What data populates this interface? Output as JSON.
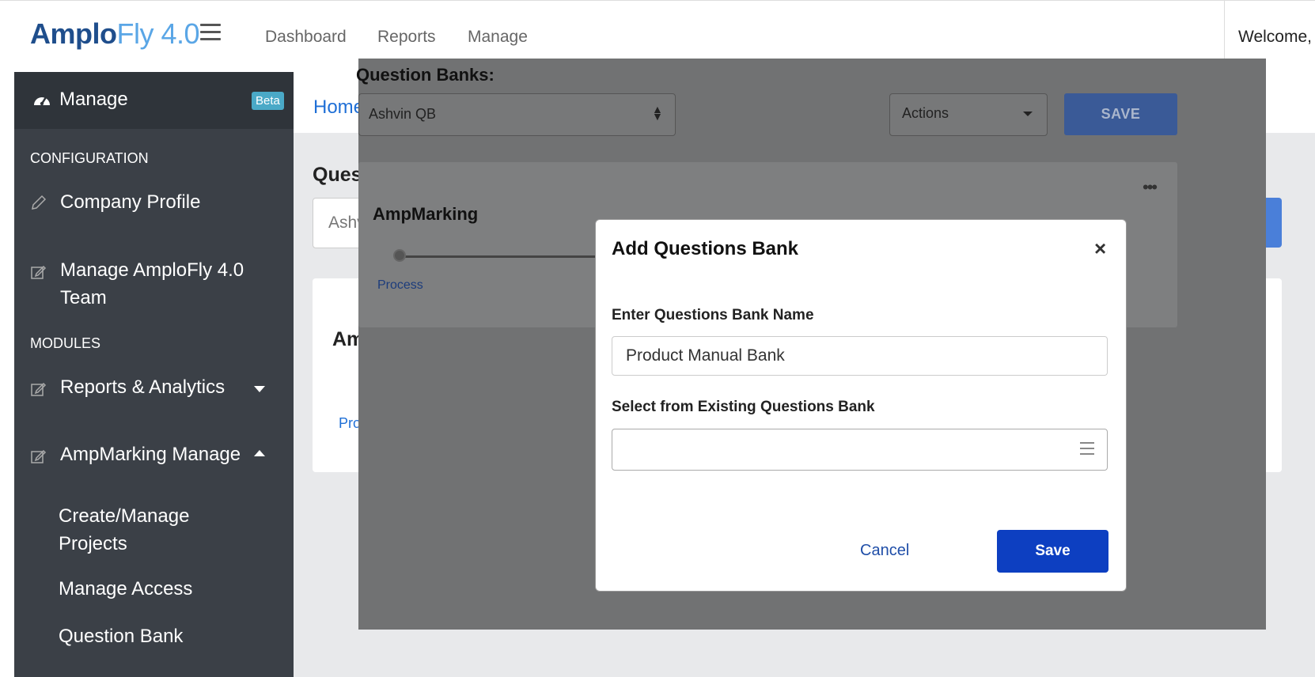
{
  "header": {
    "logo_bold": "Amplo",
    "logo_light": "Fly 4.0",
    "nav": [
      "Dashboard",
      "Reports",
      "Manage"
    ],
    "welcome": "Welcome,"
  },
  "sidebar": {
    "title": "Manage",
    "badge": "Beta",
    "section_config": "CONFIGURATION",
    "company_profile": "Company Profile",
    "manage_team_line1": "Manage AmploFly 4.0",
    "manage_team_line2": "Team",
    "section_modules": "MODULES",
    "reports_analytics": "Reports & Analytics",
    "ampmarking_manage": "AmpMarking Manage",
    "sub_create_line1": "Create/Manage",
    "sub_create_line2": "Projects",
    "sub_access": "Manage Access",
    "sub_question_bank": "Question Bank"
  },
  "background": {
    "breadcrumb_home": "Home",
    "title_fragment": "Ques",
    "select_fragment": "Ashv",
    "card_title_fragment": "Am",
    "card_link_fragment": "Pro"
  },
  "overlay": {
    "label": "Question Banks:",
    "selected_bank": "Ashvin QB",
    "actions": "Actions",
    "save": "SAVE",
    "panel_title": "AmpMarking",
    "stage_label": "Process",
    "right_fragment": "n"
  },
  "modal": {
    "title": "Add Questions Bank",
    "name_label": "Enter Questions Bank Name",
    "name_value": "Product Manual Bank",
    "existing_label": "Select from Existing Questions Bank",
    "cancel": "Cancel",
    "save": "Save"
  },
  "colors": {
    "sidebar": "#3b4047",
    "primary": "#0d3fc1",
    "link": "#1f6fd6",
    "beta_badge": "#4aa9c7"
  }
}
